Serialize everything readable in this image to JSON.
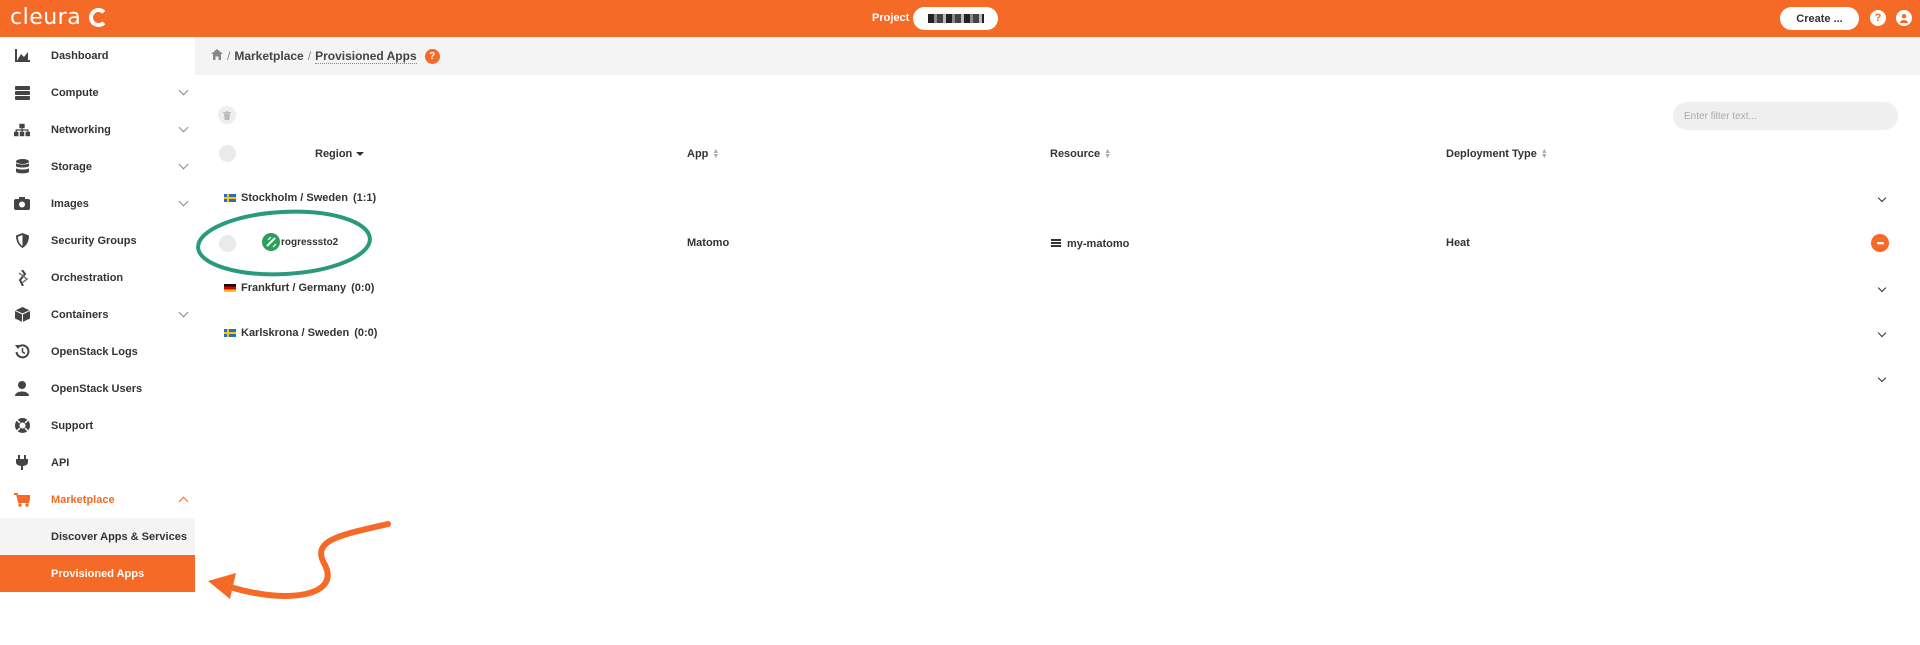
{
  "topbar": {
    "logo_text": "cleura",
    "project_label": "Project",
    "create_label": "Create ...",
    "help_icon": "?",
    "accent_color": "#f56a26"
  },
  "sidebar": {
    "items": [
      {
        "label": "Dashboard",
        "icon": "chart-icon"
      },
      {
        "label": "Compute",
        "icon": "server-icon"
      },
      {
        "label": "Networking",
        "icon": "network-icon"
      },
      {
        "label": "Storage",
        "icon": "database-icon"
      },
      {
        "label": "Images",
        "icon": "camera-icon"
      },
      {
        "label": "Security Groups",
        "icon": "shield-icon"
      },
      {
        "label": "Orchestration",
        "icon": "layers-icon"
      },
      {
        "label": "Containers",
        "icon": "cube-icon"
      },
      {
        "label": "OpenStack Logs",
        "icon": "history-icon"
      },
      {
        "label": "OpenStack Users",
        "icon": "user-icon"
      },
      {
        "label": "Support",
        "icon": "lifebuoy-icon"
      },
      {
        "label": "API",
        "icon": "plug-icon"
      },
      {
        "label": "Marketplace",
        "icon": "cart-icon"
      }
    ],
    "subitems": [
      {
        "label": "Discover Apps & Services"
      },
      {
        "label": "Provisioned Apps"
      }
    ]
  },
  "breadcrumb": {
    "sep": "/",
    "parent": "Marketplace",
    "current": "Provisioned Apps",
    "help": "?"
  },
  "table": {
    "filter_placeholder": "Enter filter text...",
    "columns": [
      "Region",
      "App",
      "Resource",
      "Deployment Type"
    ],
    "groups": [
      {
        "label": "Stockholm / Sweden",
        "count": "(1:1)",
        "flag": "se"
      },
      {
        "label": "Frankfurt / Germany",
        "count": "(0:0)",
        "flag": "de"
      },
      {
        "label": "Karlskrona / Sweden",
        "count": "(0:0)",
        "flag": "se"
      }
    ],
    "row": {
      "name": "rogresssto2",
      "app": "Matomo",
      "resource": "my-matomo",
      "deployment_type": "Heat"
    }
  }
}
